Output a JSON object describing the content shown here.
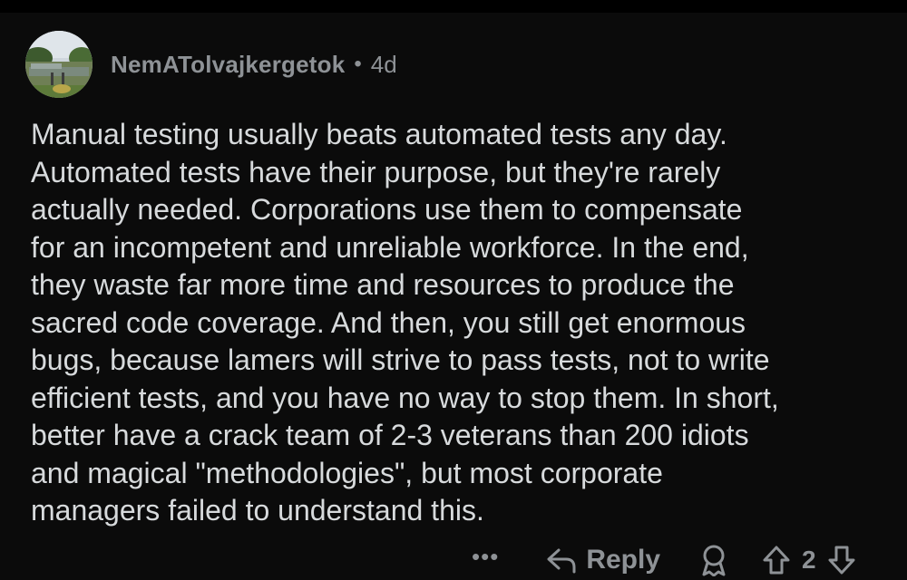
{
  "comment": {
    "username": "NemATolvajkergetok",
    "separator": "•",
    "time": "4d",
    "body": "Manual testing usually beats automated tests any day.\nAutomated tests have their purpose, but they're rarely\nactually needed. Corporations use them to compensate\nfor an incompetent and unreliable workforce. In the end,\nthey waste far more time and resources to produce the\nsacred code coverage. And then, you still get enormous\nbugs, because lamers will strive to pass tests, not to write\nefficient tests, and you have no way to stop them. In short,\nbetter have a crack team of 2-3 veterans than 200 idiots\nand magical \"methodologies\", but most corporate\nmanagers failed to understand this."
  },
  "actions": {
    "more_label": "•••",
    "reply_label": "Reply",
    "score": "2"
  },
  "icons": {
    "more": "more-options-icon",
    "reply": "reply-arrow-icon",
    "award": "award-icon",
    "upvote": "upvote-arrow-icon",
    "downvote": "downvote-arrow-icon"
  },
  "colors": {
    "background": "#0b0b0b",
    "text": "#d7dadc",
    "muted": "#8e9296"
  }
}
